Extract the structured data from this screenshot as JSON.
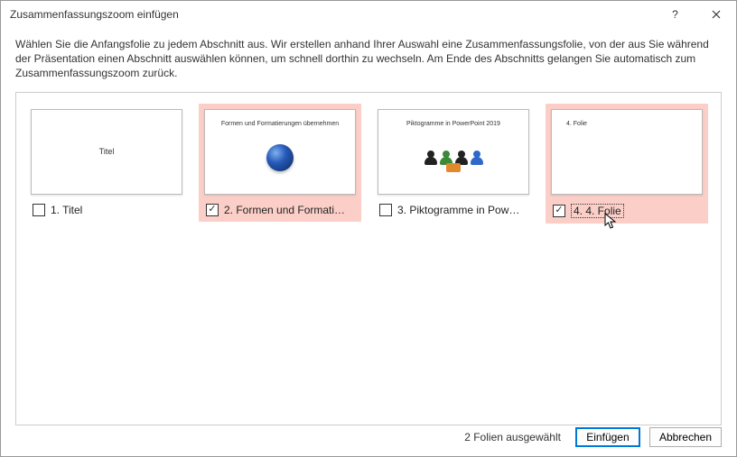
{
  "window": {
    "title": "Zusammenfassungszoom einfügen"
  },
  "description": "Wählen Sie die Anfangsfolie zu jedem Abschnitt aus. Wir erstellen anhand Ihrer Auswahl eine Zusammenfassungsfolie, von der aus Sie während der Präsentation einen Abschnitt auswählen können, um schnell dorthin zu wechseln. Am Ende des Abschnitts gelangen Sie automatisch zum Zusammenfassungszoom zurück.",
  "slides": [
    {
      "label": "1. Titel",
      "thumb_text": "Titel",
      "checked": false,
      "selected": false
    },
    {
      "label": "2. Formen und Formatier...",
      "thumb_text": "Formen und Formatierungen übernehmen",
      "checked": true,
      "selected": true
    },
    {
      "label": "3. Piktogramme in Power...",
      "thumb_text": "Piktogramme in PowerPoint 2019",
      "checked": false,
      "selected": false
    },
    {
      "label": "4. 4. Folie",
      "thumb_text": "4. Folie",
      "checked": true,
      "selected": true
    }
  ],
  "footer": {
    "status": "2 Folien ausgewählt",
    "insert": "Einfügen",
    "cancel": "Abbrechen"
  }
}
